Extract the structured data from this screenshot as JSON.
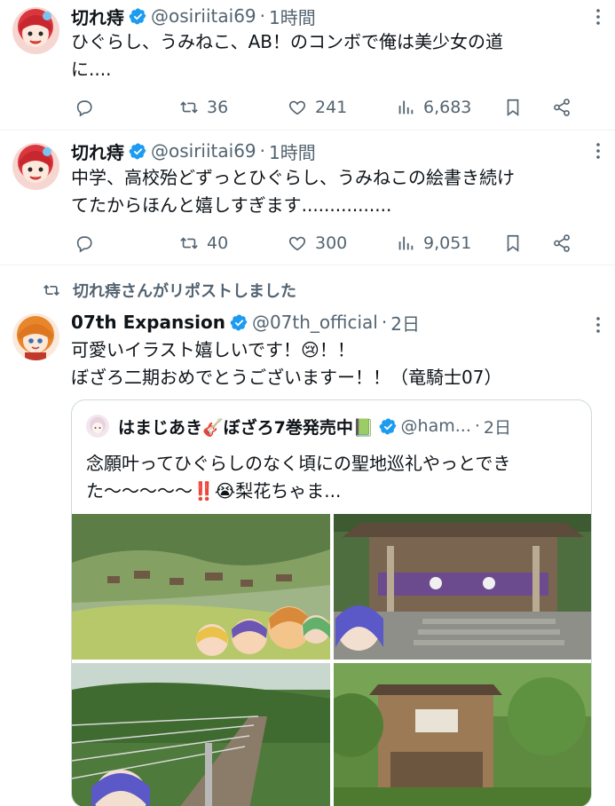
{
  "tweets": [
    {
      "author": "切れ痔",
      "handle": "@osiriitai69",
      "separator": "·",
      "time": "1時間",
      "text": "ひぐらし、うみねこ、AB！のコンボで俺は美少女の道\nに....",
      "stats": {
        "reposts": "36",
        "likes": "241",
        "views": "6,683"
      }
    },
    {
      "author": "切れ痔",
      "handle": "@osiriitai69",
      "separator": "·",
      "time": "1時間",
      "text": "中学、高校殆どずっとひぐらし、うみねこの絵書き続け\nてたからほんと嬉しすぎます................",
      "stats": {
        "reposts": "40",
        "likes": "300",
        "views": "9,051"
      }
    }
  ],
  "repost_banner": "切れ痔さんがリポストしました",
  "retweeted": {
    "author": "07th Expansion",
    "handle": "@07th_official",
    "separator": "·",
    "time": "2日",
    "text": "可愛いイラスト嬉しいです！😢！！\nぼざろ二期おめでとうございますー！！（竜騎士07）",
    "quote": {
      "author": "はまじあき🎸ぼざろ7巻発売中📗",
      "handle": "@ham...",
      "separator": "·",
      "time": "2日",
      "text": "念願叶ってひぐらしのなく頃にの聖地巡礼やっとできた〜〜〜〜〜‼️😭梨花ちゃま..."
    }
  },
  "colors": {
    "text_primary": "#0f1419",
    "text_secondary": "#536471",
    "verified_blue": "#1d9bf0",
    "border": "#cfd9de",
    "divider": "#eff3f4"
  },
  "icons": [
    "more-icon",
    "verified-badge-icon",
    "reply-icon",
    "repost-icon",
    "like-icon",
    "views-icon",
    "bookmark-icon",
    "share-icon"
  ]
}
